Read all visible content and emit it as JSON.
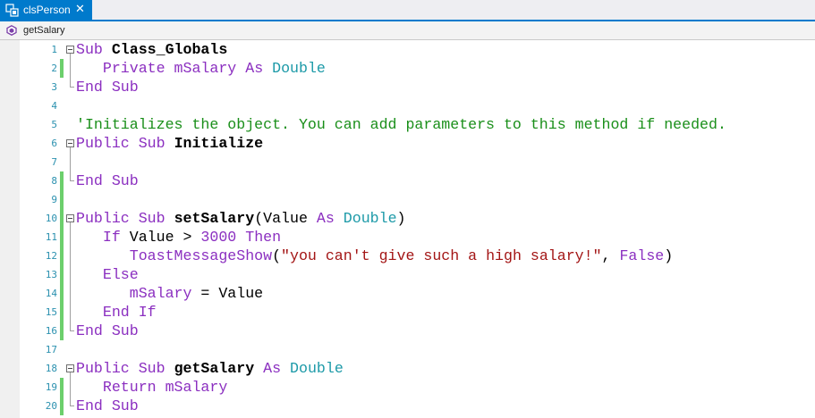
{
  "tab": {
    "label": "clsPerson",
    "close": "✕"
  },
  "member_bar": {
    "label": "getSalary"
  },
  "colors": {
    "accent": "#007acc",
    "keyword": "#8b2fc0",
    "type": "#1d9aa8",
    "string": "#a31515",
    "comment": "#1a8f1a",
    "line_number": "#2b91af",
    "change_marker": "#6ccf6c"
  },
  "lines": [
    {
      "num": "1",
      "tokens": [
        {
          "t": "Sub",
          "c": "kw"
        },
        {
          "t": " "
        },
        {
          "t": "Class_Globals",
          "c": "bold"
        }
      ]
    },
    {
      "num": "2",
      "tokens": [
        {
          "t": "   "
        },
        {
          "t": "Private",
          "c": "kw"
        },
        {
          "t": " mSalary",
          "c": "kw"
        },
        {
          "t": " "
        },
        {
          "t": "As",
          "c": "kw"
        },
        {
          "t": " "
        },
        {
          "t": "Double",
          "c": "ty"
        }
      ]
    },
    {
      "num": "3",
      "tokens": [
        {
          "t": "End Sub",
          "c": "kw"
        }
      ]
    },
    {
      "num": "4",
      "tokens": []
    },
    {
      "num": "5",
      "tokens": [
        {
          "t": "'Initializes the object. You can add parameters to this method if needed.",
          "c": "cmt"
        }
      ]
    },
    {
      "num": "6",
      "tokens": [
        {
          "t": "Public Sub",
          "c": "kw"
        },
        {
          "t": " "
        },
        {
          "t": "Initialize",
          "c": "bold"
        }
      ]
    },
    {
      "num": "7",
      "tokens": []
    },
    {
      "num": "8",
      "tokens": [
        {
          "t": "End Sub",
          "c": "kw"
        }
      ]
    },
    {
      "num": "9",
      "tokens": []
    },
    {
      "num": "10",
      "tokens": [
        {
          "t": "Public Sub",
          "c": "kw"
        },
        {
          "t": " "
        },
        {
          "t": "setSalary",
          "c": "bold"
        },
        {
          "t": "(Value "
        },
        {
          "t": "As",
          "c": "kw"
        },
        {
          "t": " "
        },
        {
          "t": "Double",
          "c": "ty"
        },
        {
          "t": ")"
        }
      ]
    },
    {
      "num": "11",
      "tokens": [
        {
          "t": "   "
        },
        {
          "t": "If",
          "c": "kw"
        },
        {
          "t": " Value > "
        },
        {
          "t": "3000",
          "c": "num"
        },
        {
          "t": " "
        },
        {
          "t": "Then",
          "c": "kw"
        }
      ]
    },
    {
      "num": "12",
      "tokens": [
        {
          "t": "      "
        },
        {
          "t": "ToastMessageShow",
          "c": "kw"
        },
        {
          "t": "("
        },
        {
          "t": "\"you can't give such a high salary!\"",
          "c": "str"
        },
        {
          "t": ", "
        },
        {
          "t": "False",
          "c": "kw"
        },
        {
          "t": ")"
        }
      ]
    },
    {
      "num": "13",
      "tokens": [
        {
          "t": "   "
        },
        {
          "t": "Else",
          "c": "kw"
        }
      ]
    },
    {
      "num": "14",
      "tokens": [
        {
          "t": "      "
        },
        {
          "t": "mSalary",
          "c": "kw"
        },
        {
          "t": " = Value"
        }
      ]
    },
    {
      "num": "15",
      "tokens": [
        {
          "t": "   "
        },
        {
          "t": "End If",
          "c": "kw"
        }
      ]
    },
    {
      "num": "16",
      "tokens": [
        {
          "t": "End Sub",
          "c": "kw"
        }
      ]
    },
    {
      "num": "17",
      "tokens": []
    },
    {
      "num": "18",
      "tokens": [
        {
          "t": "Public Sub",
          "c": "kw"
        },
        {
          "t": " "
        },
        {
          "t": "getSalary",
          "c": "bold"
        },
        {
          "t": " "
        },
        {
          "t": "As",
          "c": "kw"
        },
        {
          "t": " "
        },
        {
          "t": "Double",
          "c": "ty"
        }
      ]
    },
    {
      "num": "19",
      "tokens": [
        {
          "t": "   "
        },
        {
          "t": "Return",
          "c": "kw"
        },
        {
          "t": " mSalary",
          "c": "kw"
        }
      ]
    },
    {
      "num": "20",
      "tokens": [
        {
          "t": "End Sub",
          "c": "kw"
        }
      ]
    }
  ]
}
